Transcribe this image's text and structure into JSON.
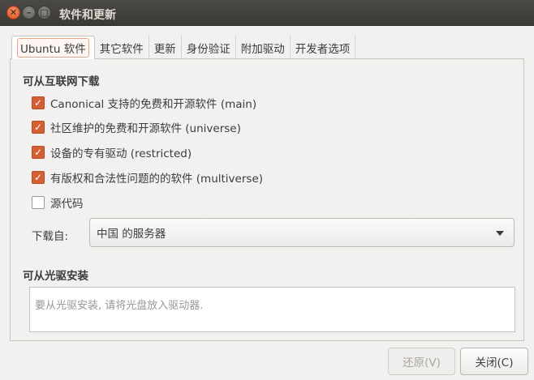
{
  "window": {
    "title": "软件和更新",
    "close_glyph": "✕",
    "min_glyph": "–",
    "max_glyph": "□"
  },
  "tabs": [
    {
      "label": "Ubuntu 软件",
      "active": true
    },
    {
      "label": "其它软件",
      "active": false
    },
    {
      "label": "更新",
      "active": false
    },
    {
      "label": "身份验证",
      "active": false
    },
    {
      "label": "附加驱动",
      "active": false
    },
    {
      "label": "开发者选项",
      "active": false
    }
  ],
  "download_section": {
    "title": "可从互联网下载",
    "checkboxes": [
      {
        "label": "Canonical 支持的免费和开源软件 (main)",
        "checked": true
      },
      {
        "label": "社区维护的免费和开源软件 (universe)",
        "checked": true
      },
      {
        "label": "设备的专有驱动 (restricted)",
        "checked": true
      },
      {
        "label": "有版权和合法性问题的的软件 (multiverse)",
        "checked": true
      },
      {
        "label": "源代码",
        "checked": false
      }
    ],
    "download_from_label": "下载自:",
    "server_selected": "中国 的服务器"
  },
  "cdrom_section": {
    "title": "可从光驱安装",
    "placeholder": "要从光驱安装, 请将光盘放入驱动器."
  },
  "buttons": {
    "revert": "还原(V)",
    "close": "关闭(C)"
  },
  "icons": {
    "check": "check-icon",
    "dropdown": "chevron-down-icon"
  },
  "colors": {
    "accent": "#d35f35",
    "titlebar": "#3c3b37"
  }
}
